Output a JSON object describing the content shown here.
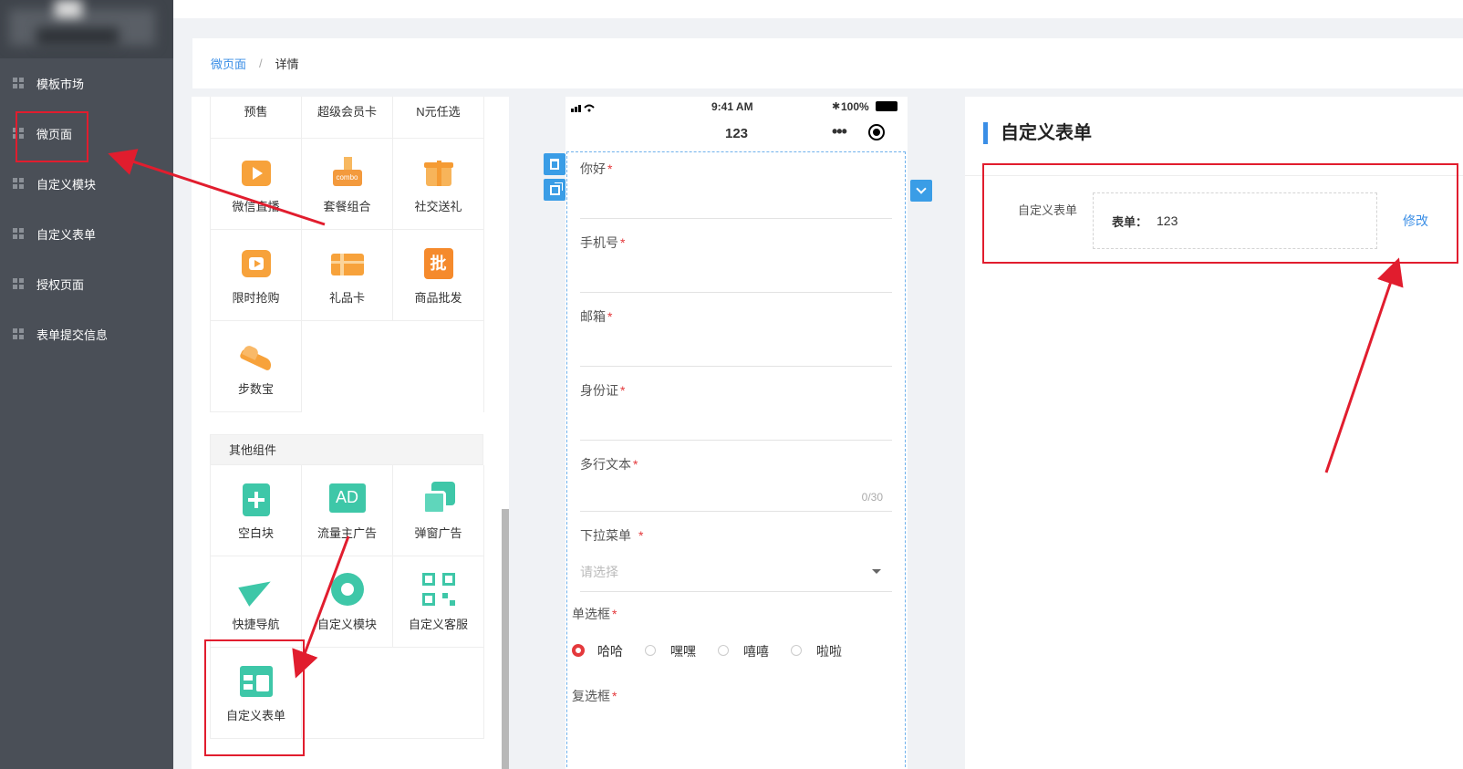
{
  "sidebar": {
    "items": [
      {
        "label": "模板市场"
      },
      {
        "label": "微页面"
      },
      {
        "label": "自定义模块"
      },
      {
        "label": "自定义表单"
      },
      {
        "label": "授权页面"
      },
      {
        "label": "表单提交信息"
      }
    ]
  },
  "breadcrumb": {
    "root": "微页面",
    "separator": "/",
    "current": "详情"
  },
  "components": {
    "marketing_top": [
      "预售",
      "超级会员卡",
      "N元任选"
    ],
    "marketing": [
      "微信直播",
      "套餐组合",
      "社交送礼",
      "限时抢购",
      "礼品卡",
      "商品批发",
      "步数宝"
    ],
    "other_title": "其他组件",
    "other": [
      "空白块",
      "流量主广告",
      "弹窗广告",
      "快捷导航",
      "自定义模块",
      "自定义客服",
      "自定义表单"
    ],
    "icon_texts": {
      "combo": "combo",
      "pi": "批",
      "ad": "AD"
    }
  },
  "phone": {
    "status": {
      "time": "9:41 AM",
      "battery": "100%"
    },
    "title": "123",
    "fields": [
      {
        "label": "你好",
        "required": "*"
      },
      {
        "label": "手机号",
        "required": "*"
      },
      {
        "label": "邮箱",
        "required": "*"
      },
      {
        "label": "身份证",
        "required": "*"
      },
      {
        "label": "多行文本",
        "required": "*",
        "counter": "0/30"
      }
    ],
    "dropdown": {
      "label": "下拉菜单",
      "required": "*",
      "placeholder": "请选择"
    },
    "radio": {
      "label": "单选框",
      "required": "*",
      "options": [
        "哈哈",
        "嘿嘿",
        "嘻嘻",
        "啦啦"
      ],
      "selected": "哈哈"
    },
    "checkbox": {
      "label": "复选框",
      "required": "*"
    }
  },
  "right": {
    "title": "自定义表单",
    "field_label": "自定义表单",
    "form_key": "表单：",
    "form_value": "123",
    "edit": "修改"
  },
  "colors": {
    "accent": "#3a8ee6",
    "sidebar": "#4a4f57",
    "annotation": "#e11d2e",
    "required": "#e4393c"
  }
}
